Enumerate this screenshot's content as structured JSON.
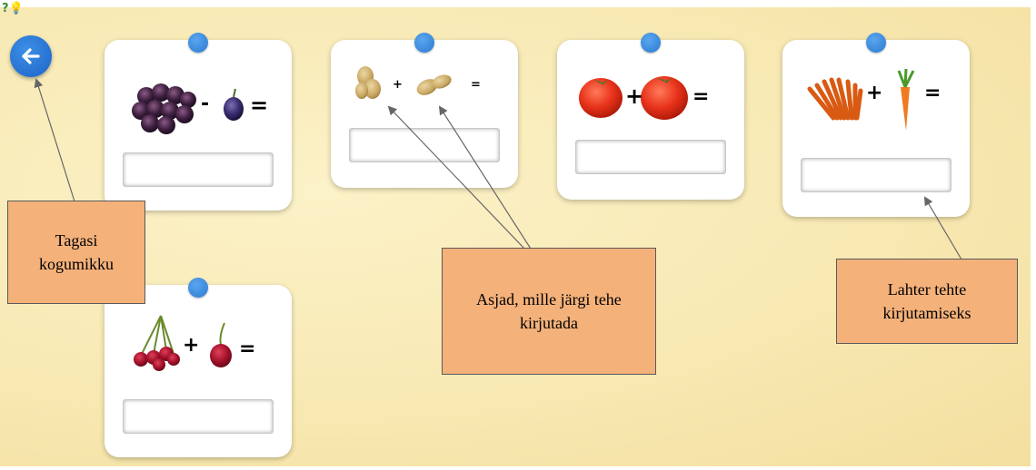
{
  "app": {
    "icons": [
      "help-icon",
      "lightbulb-icon"
    ]
  },
  "back_button": {
    "icon": "arrow-left-icon"
  },
  "cards": [
    {
      "id": "plums",
      "operator": "-",
      "equals": "="
    },
    {
      "id": "potatoes",
      "operator": "+",
      "equals": "="
    },
    {
      "id": "tomatoes",
      "operator": "+",
      "equals": "="
    },
    {
      "id": "carrots",
      "operator": "+",
      "equals": "="
    },
    {
      "id": "cherries",
      "operator": "+",
      "equals": "="
    }
  ],
  "callouts": {
    "back": "Tagasi kogumikku",
    "things": "Asjad, mille järgi tehe kirjutada",
    "field": "Lahter tehte kirjutamiseks"
  },
  "colors": {
    "accent": "#1c63c8",
    "callout_fill": "#f4b17a",
    "background": "#f8e9b3"
  }
}
